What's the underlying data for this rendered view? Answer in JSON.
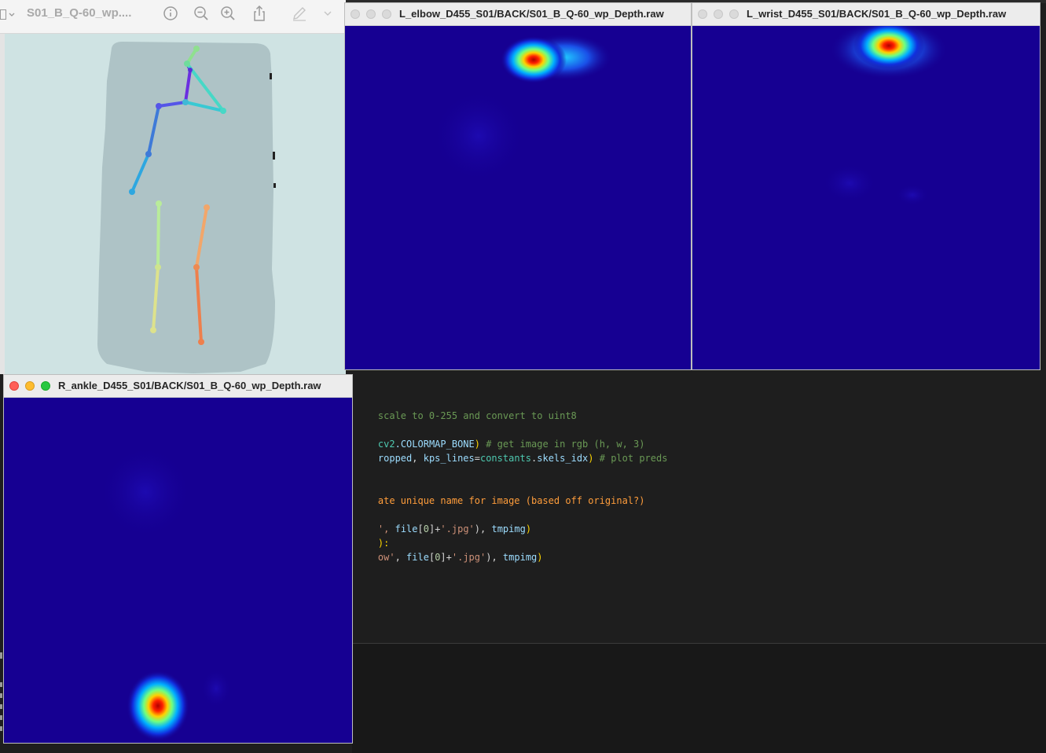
{
  "preview": {
    "title": "S01_B_Q-60_wp....",
    "toolbar": {
      "info_icon": "info-icon",
      "zoom_out_icon": "zoom-out-icon",
      "zoom_in_icon": "zoom-in-icon",
      "share_icon": "share-icon",
      "markup_icon": "pen-icon",
      "more_icon": "chevron-down-icon"
    }
  },
  "windows": {
    "l_elbow": {
      "title": "L_elbow_D455_S01/BACK/S01_B_Q-60_wp_Depth.raw"
    },
    "l_wrist": {
      "title": "L_wrist_D455_S01/BACK/S01_B_Q-60_wp_Depth.raw"
    },
    "r_ankle": {
      "title": "R_ankle_D455_S01/BACK/S01_B_Q-60_wp_Depth.raw"
    }
  },
  "colors": {
    "heatmap_background": "#160092",
    "editor_background": "#1e1e1e",
    "preview_background": "#cfe3e3"
  },
  "code": {
    "line1": "scale to 0-255 and convert to uint8",
    "line2_a": "cv2",
    "line2_b": ".COLORMAP_BONE",
    "line2_c": ")",
    "line2_comment": " # get image in rgb (h, w, 3)",
    "line3_a": "ropped",
    "line3_b": ", ",
    "line3_c": "kps_lines",
    "line3_d": "=",
    "line3_e": "constants",
    "line3_f": ".",
    "line3_g": "skels_idx",
    "line3_h": ")",
    "line3_comment": " # plot preds",
    "line4": "ate unique name for image (based off original?)",
    "line5_a": "', ",
    "line5_b": "file",
    "line5_c": "[",
    "line5_d": "0",
    "line5_e": "]+",
    "line5_f": "'.jpg'",
    "line5_g": "), ",
    "line5_h": "tmpimg",
    "line5_i": ")",
    "line6": "):",
    "line7_a": "ow'",
    "line7_b": ", ",
    "line7_c": "file",
    "line7_d": "[",
    "line7_e": "0",
    "line7_f": "]+",
    "line7_g": "'.jpg'",
    "line7_h": "), ",
    "line7_i": "tmpimg",
    "line7_j": ")"
  }
}
